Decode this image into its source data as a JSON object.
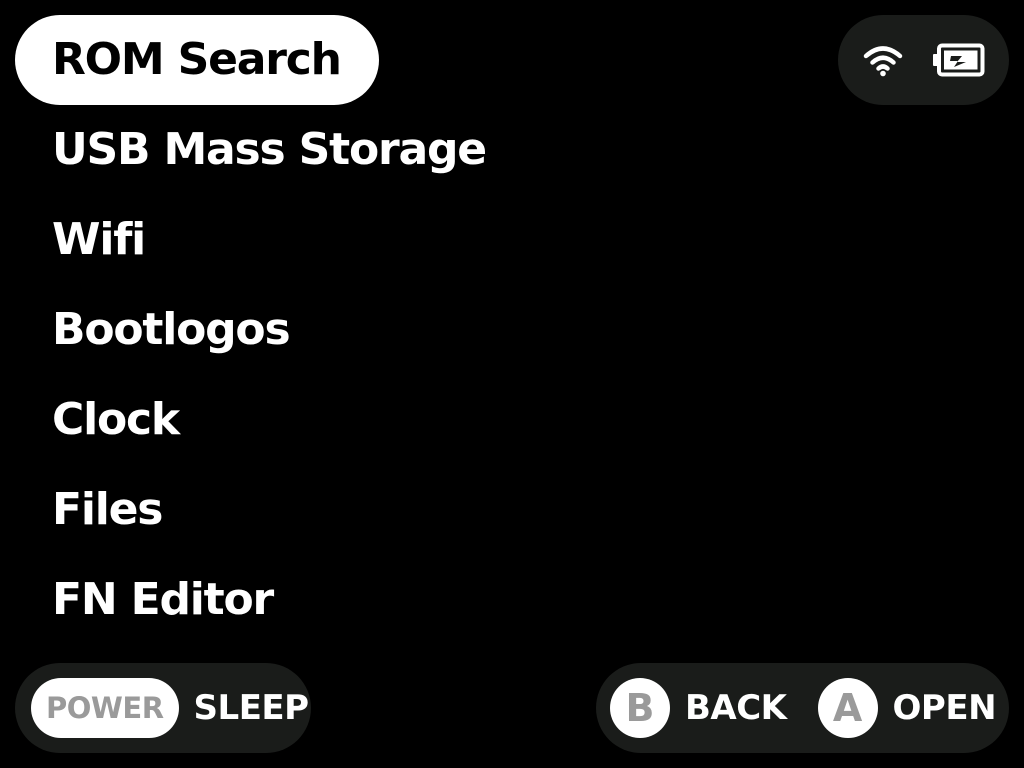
{
  "status": {
    "wifi_icon": "wifi-icon",
    "battery_icon": "battery-charging-icon"
  },
  "menu": {
    "items": [
      {
        "label": "ROM Search",
        "selected": true
      },
      {
        "label": "USB Mass Storage",
        "selected": false
      },
      {
        "label": "Wifi",
        "selected": false
      },
      {
        "label": "Bootlogos",
        "selected": false
      },
      {
        "label": "Clock",
        "selected": false
      },
      {
        "label": "Files",
        "selected": false
      },
      {
        "label": "FN Editor",
        "selected": false
      }
    ]
  },
  "hints": {
    "power_key": "POWER",
    "power_action": "SLEEP",
    "back_key": "B",
    "back_action": "BACK",
    "open_key": "A",
    "open_action": "OPEN"
  },
  "colors": {
    "background": "#000000",
    "pill": "#1a1c1a",
    "selected": "#ffffff",
    "key_glyph": "#9a9a9a"
  }
}
